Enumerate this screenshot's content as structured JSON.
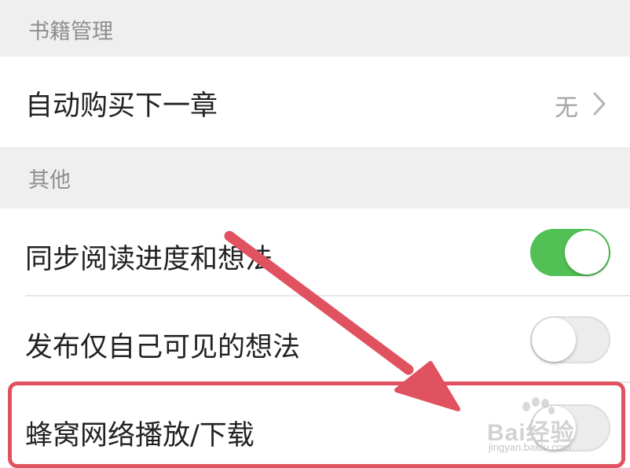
{
  "sections": {
    "book_management": {
      "title": "书籍管理"
    },
    "other": {
      "title": "其他"
    }
  },
  "auto_buy": {
    "label": "自动购买下一章",
    "value": "无"
  },
  "sync_progress": {
    "label": "同步阅读进度和想法",
    "enabled": true
  },
  "private_thoughts": {
    "label": "发布仅自己可见的想法",
    "enabled": false
  },
  "cellular": {
    "label": "蜂窝网络播放/下载",
    "enabled": false
  },
  "colors": {
    "toggle_on": "#52c054",
    "toggle_off": "#ececec",
    "annotation_red": "#e0525f",
    "background": "#efefef"
  },
  "watermark": {
    "brand": "Bai经验",
    "url": "jingyan.baidu.com"
  }
}
